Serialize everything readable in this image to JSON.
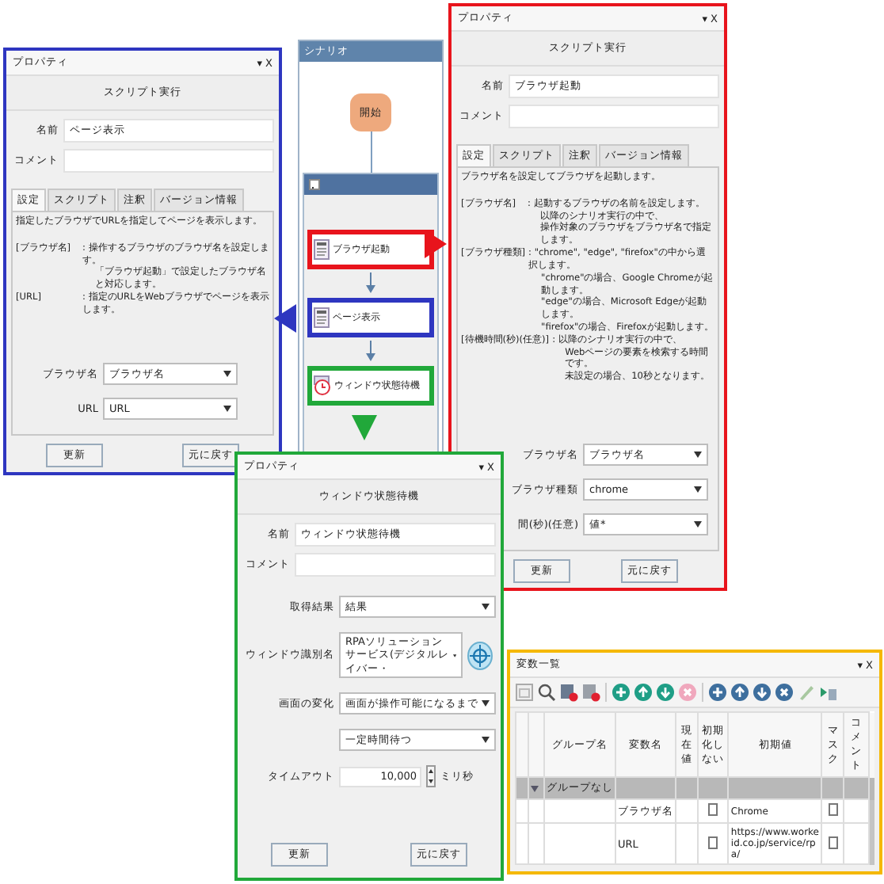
{
  "scenario": {
    "title": "シナリオ",
    "start": "開始",
    "nodes": [
      {
        "label": "ブラウザ起動",
        "color": "#e8141c",
        "kind": "script"
      },
      {
        "label": "ページ表示",
        "color": "#2e36c0",
        "kind": "script"
      },
      {
        "label": "ウィンドウ状態待機",
        "color": "#21a83a",
        "kind": "wait"
      }
    ]
  },
  "property_windows": [
    {
      "title": "プロパティ",
      "pin": "▾",
      "close": "X",
      "color": "#2e36c0",
      "header": "スクリプト実行",
      "name_label": "名前",
      "name_value": "ページ表示",
      "comment_label": "コメント",
      "tabs": [
        {
          "label": "設定",
          "selected": true
        },
        {
          "label": "スクリプト",
          "selected": false
        },
        {
          "label": "注釈",
          "selected": false
        },
        {
          "label": "バージョン情報",
          "selected": false
        }
      ],
      "description": {
        "intro": "指定したブラウザでURLを指定してページを表示します。",
        "params": [
          {
            "key": "[ブラウザ名]",
            "lines": [
              ": 操作するブラウザのブラウザ名を設定します。",
              "「ブラウザ起動」で設定したブラウザ名と対応します。"
            ]
          },
          {
            "key": "[URL]",
            "lines": [
              ": 指定のURLをWebブラウザでページを表示します。"
            ]
          }
        ]
      },
      "fields": [
        {
          "kind": "select",
          "label": "ブラウザ名",
          "value": "ブラウザ名"
        },
        {
          "kind": "select",
          "label": "URL",
          "value": "URL"
        }
      ],
      "buttons": [
        "更新",
        "元に戻す"
      ]
    },
    {
      "title": "プロパティ",
      "pin": "▾",
      "close": "X",
      "color": "#e8141c",
      "header": "スクリプト実行",
      "name_label": "名前",
      "name_value": "ブラウザ起動",
      "comment_label": "コメント",
      "tabs": [
        {
          "label": "設定",
          "selected": true
        },
        {
          "label": "スクリプト",
          "selected": false
        },
        {
          "label": "注釈",
          "selected": false
        },
        {
          "label": "バージョン情報",
          "selected": false
        }
      ],
      "description": {
        "intro": "ブラウザ名を設定してブラウザを起動します。",
        "params": [
          {
            "key": "[ブラウザ名]",
            "lines": [
              ": 起動するブラウザの名前を設定します。",
              "以降のシナリオ実行の中で、",
              "操作対象のブラウザをブラウザ名で指定します。"
            ]
          },
          {
            "key": "[ブラウザ種類]",
            "lines": [
              ": \"chrome\", \"edge\", \"firefox\"の中から選択します。",
              "\"chrome\"の場合、Google Chromeが起動します。",
              "\"edge\"の場合、Microsoft Edgeが起動します。",
              "\"firefox\"の場合、Firefoxが起動します。"
            ]
          },
          {
            "key": "[待機時間(秒)(任意)]",
            "lines": [
              ": 以降のシナリオ実行の中で、",
              "Webページの要素を検索する時間です。",
              "未設定の場合、10秒となります。"
            ]
          }
        ]
      },
      "fields": [
        {
          "kind": "select",
          "label": "ブラウザ名",
          "value": "ブラウザ名"
        },
        {
          "kind": "select",
          "label": "ブラウザ種類",
          "value": "chrome"
        },
        {
          "kind": "select",
          "label": "間(秒)(任意)",
          "value": "値*"
        }
      ],
      "buttons": [
        "更新",
        "元に戻す"
      ]
    },
    {
      "title": "プロパティ",
      "pin": "▾",
      "close": "X",
      "color": "#21a83a",
      "header": "ウィンドウ状態待機",
      "name_label": "名前",
      "name_value": "ウィンドウ状態待機",
      "comment_label": "コメント",
      "fields": [
        {
          "kind": "select",
          "label": "取得結果",
          "value": "結果"
        },
        {
          "kind": "select_target",
          "label": "ウィンドウ識別名",
          "value": "RPAソリューションサービス(デジタルレイバー・"
        },
        {
          "kind": "select",
          "label": "画面の変化",
          "value": "画面が操作可能になるまで"
        },
        {
          "kind": "select",
          "value": "一定時間待つ"
        },
        {
          "kind": "number",
          "label": "タイムアウト",
          "value": "10,000",
          "unit": "ミリ秒"
        }
      ],
      "buttons": [
        "更新",
        "元に戻す"
      ]
    }
  ],
  "variables_window": {
    "title": "変数一覧",
    "pin": "▾",
    "close": "X",
    "color": "#f5b800",
    "columns": [
      "グループ名",
      "変数名",
      "現在値",
      "初期化しない",
      "初期値",
      "マスク",
      "コメント"
    ],
    "group": {
      "label": "グループなし",
      "expanded": true
    },
    "rows": [
      {
        "name": "ブラウザ名",
        "no_init": false,
        "initial": "Chrome",
        "mask": false
      },
      {
        "name": "URL",
        "no_init": false,
        "initial": "https://www.workeid.co.jp/service/rpa/",
        "mask": false
      }
    ]
  }
}
